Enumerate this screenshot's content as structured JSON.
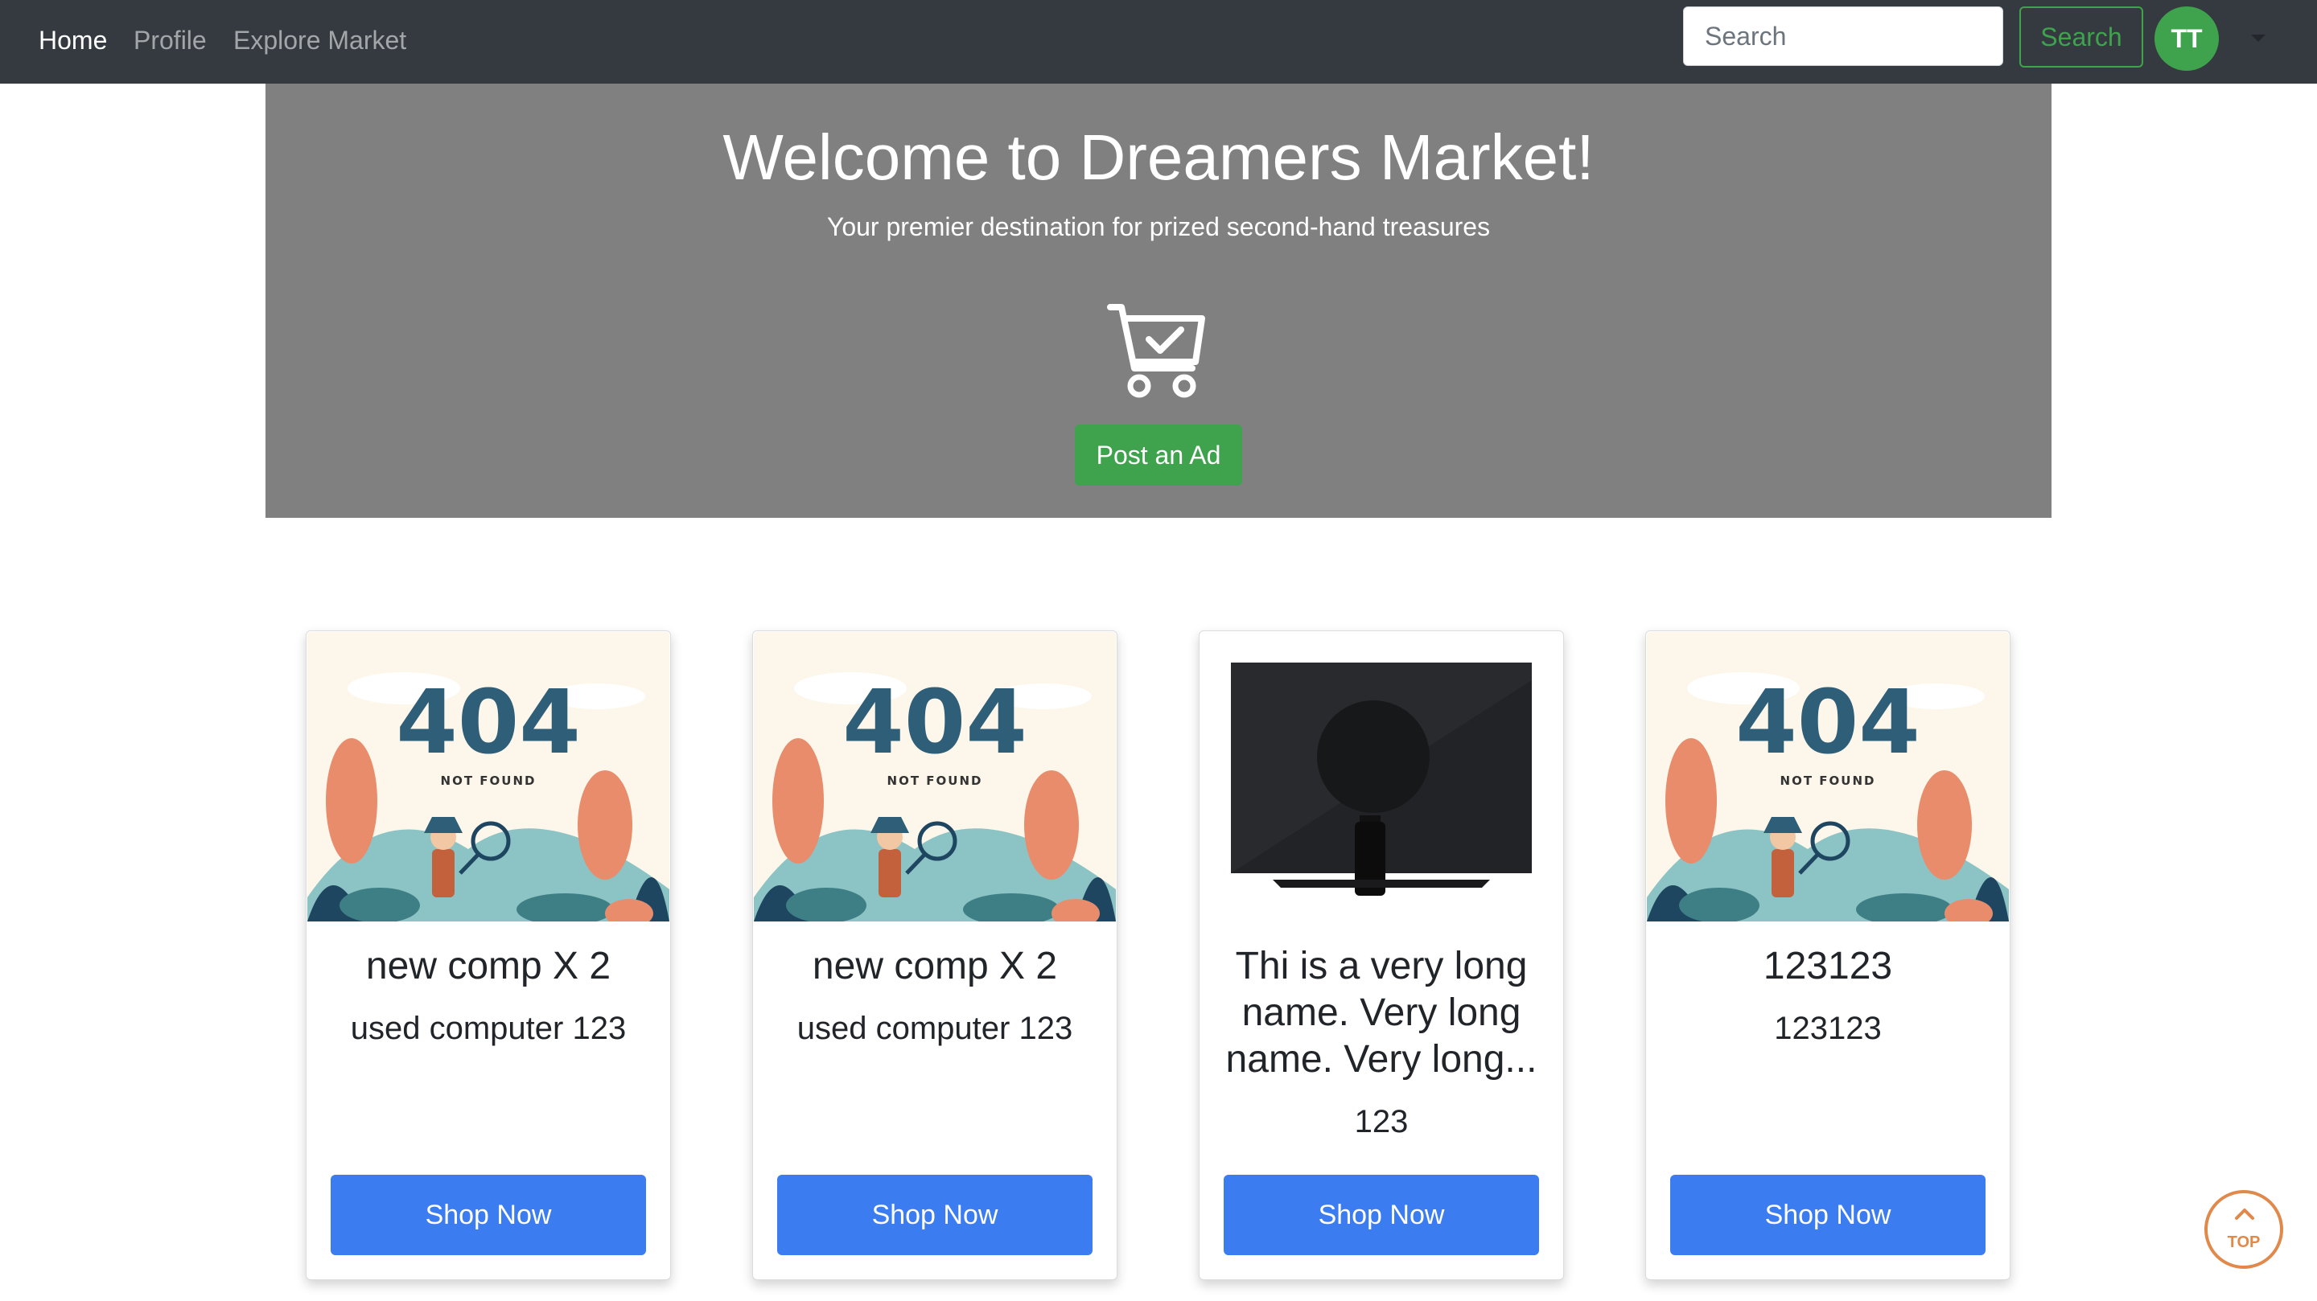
{
  "nav": {
    "links": [
      {
        "label": "Home",
        "active": true
      },
      {
        "label": "Profile",
        "active": false
      },
      {
        "label": "Explore Market",
        "active": false
      }
    ],
    "search_placeholder": "Search",
    "search_button": "Search",
    "avatar_initials": "TT"
  },
  "hero": {
    "title": "Welcome to Dreamers Market!",
    "subtitle": "Your premier destination for prized second-hand treasures",
    "icon": "shopping-cart-check-icon",
    "post_button": "Post an Ad"
  },
  "cards": [
    {
      "image": "404-not-found-illustration",
      "image_text_main": "404",
      "image_text_sub": "NOT FOUND",
      "title": "new comp X 2",
      "description": "used computer 123",
      "button": "Shop Now"
    },
    {
      "image": "404-not-found-illustration",
      "image_text_main": "404",
      "image_text_sub": "NOT FOUND",
      "title": "new comp X 2",
      "description": "used computer 123",
      "button": "Shop Now"
    },
    {
      "image": "computer-monitor-back-photo",
      "title_lines": [
        "Thi is a very long",
        "name. Very long",
        "name. Very long..."
      ],
      "description": "123",
      "button": "Shop Now"
    },
    {
      "image": "404-not-found-illustration",
      "image_text_main": "404",
      "image_text_sub": "NOT FOUND",
      "title": "123123",
      "description": "123123",
      "button": "Shop Now"
    }
  ],
  "back_to_top": {
    "label": "TOP",
    "icon": "chevron-up-icon"
  },
  "colors": {
    "navbar_bg": "#343a40",
    "hero_bg": "#808080",
    "success_green": "#3fa34d",
    "primary_blue": "#3b7cf1",
    "top_orange": "#e0894a"
  }
}
